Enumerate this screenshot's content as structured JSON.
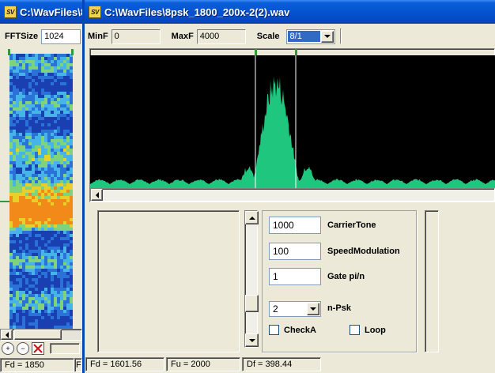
{
  "back_window": {
    "title": "C:\\WavFiles\\8psk_1800_200x-2(2).wav",
    "app_icon_label": "SV",
    "fft_size_label": "FFTSize",
    "fft_size_value": "1024",
    "status_fd": "Fd = 1850",
    "status_extra": "F"
  },
  "front_window": {
    "title": "C:\\WavFiles\\8psk_1800_200x-2(2).wav",
    "app_icon_label": "SV",
    "toolbar": {
      "minf_label": "MinF",
      "minf_value": "0",
      "maxf_label": "MaxF",
      "maxf_value": "4000",
      "scale_label": "Scale",
      "scale_value": "8/1"
    },
    "params": {
      "carrier_tone_value": "1000",
      "carrier_tone_label": "CarrierTone",
      "speed_modulation_value": "100",
      "speed_modulation_label": "SpeedModulation",
      "gate_value": "1",
      "gate_label": "Gate pi/n",
      "npsk_value": "2",
      "npsk_label": "n-Psk",
      "checka_label": "CheckA",
      "loop_label": "Loop",
      "checka_checked": false,
      "loop_checked": false
    },
    "status": {
      "fd": "Fd = 1601.56",
      "fu": "Fu = 2000",
      "df": "Df = 398.44"
    }
  },
  "colors": {
    "spectrum_fill": "#1ec77d",
    "spectrum_bg": "#000000",
    "marker_line": "#ffffff",
    "marker_tab": "#2f9a3a",
    "titlebar": "#0553d0"
  },
  "icons": {
    "zoom_in": "zoom-in-icon",
    "zoom_out": "zoom-out-icon",
    "clear": "clear-icon"
  }
}
